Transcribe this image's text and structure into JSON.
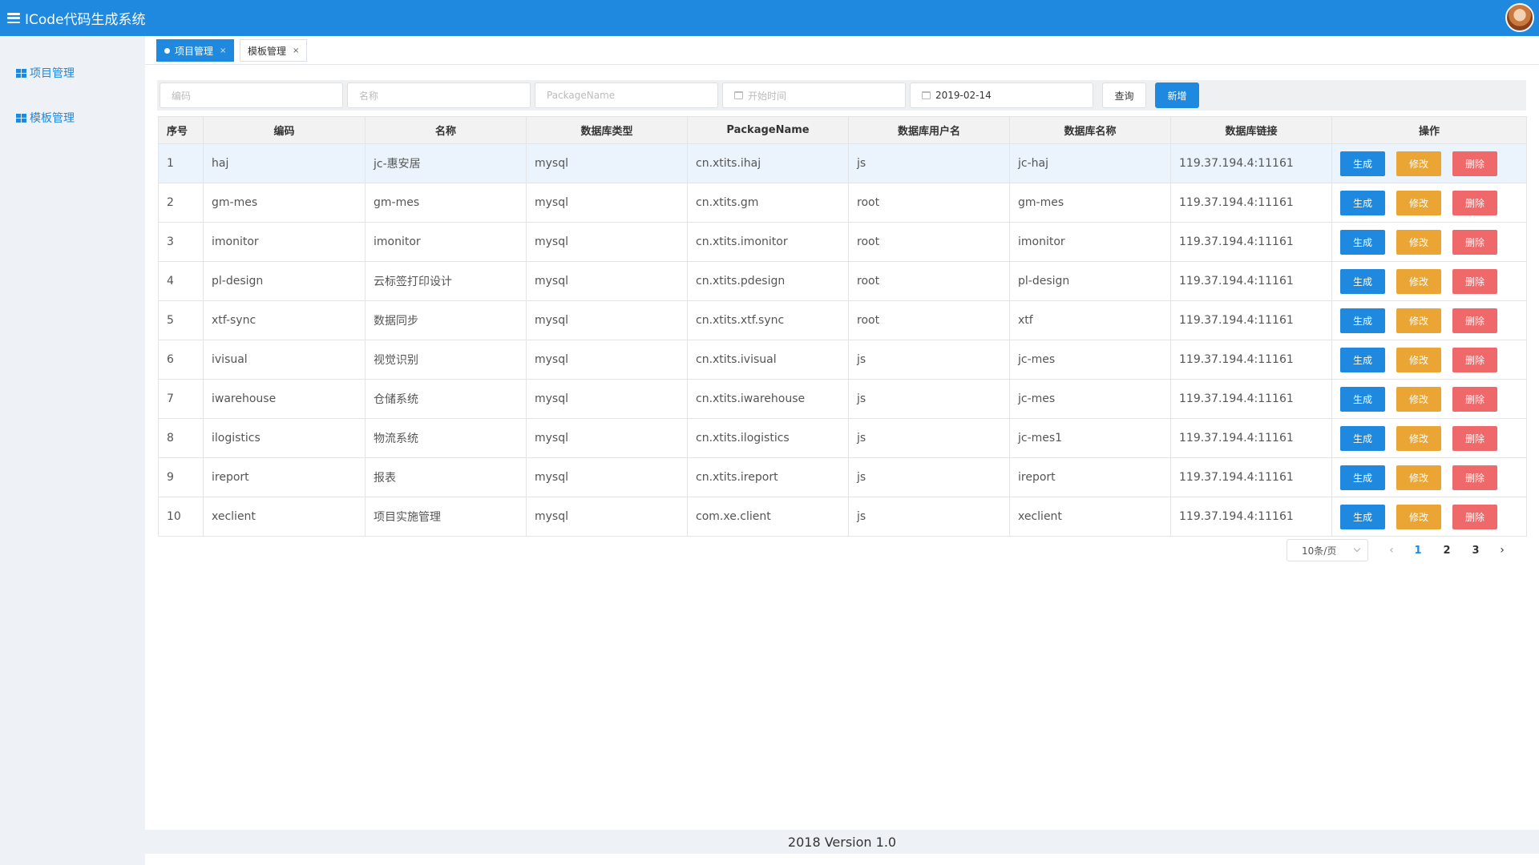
{
  "app": {
    "title": "ICode代码生成系统"
  },
  "sidebar": {
    "items": [
      {
        "label": "项目管理"
      },
      {
        "label": "模板管理"
      }
    ]
  },
  "tabs": [
    {
      "label": "项目管理",
      "active": true
    },
    {
      "label": "模板管理",
      "active": false
    }
  ],
  "search": {
    "code_placeholder": "编码",
    "name_placeholder": "名称",
    "package_placeholder": "PackageName",
    "start_placeholder": "开始时间",
    "end_value": "2019-02-14",
    "query_label": "查询",
    "add_label": "新增"
  },
  "table": {
    "headers": [
      "序号",
      "编码",
      "名称",
      "数据库类型",
      "PackageName",
      "数据库用户名",
      "数据库名称",
      "数据库链接",
      "操作"
    ],
    "rows": [
      [
        "1",
        "haj",
        "jc-惠安居",
        "mysql",
        "cn.xtits.ihaj",
        "js",
        "jc-haj",
        "119.37.194.4:11161"
      ],
      [
        "2",
        "gm-mes",
        "gm-mes",
        "mysql",
        "cn.xtits.gm",
        "root",
        "gm-mes",
        "119.37.194.4:11161"
      ],
      [
        "3",
        "imonitor",
        "imonitor",
        "mysql",
        "cn.xtits.imonitor",
        "root",
        "imonitor",
        "119.37.194.4:11161"
      ],
      [
        "4",
        "pl-design",
        "云标签打印设计",
        "mysql",
        "cn.xtits.pdesign",
        "root",
        "pl-design",
        "119.37.194.4:11161"
      ],
      [
        "5",
        "xtf-sync",
        "数据同步",
        "mysql",
        "cn.xtits.xtf.sync",
        "root",
        "xtf",
        "119.37.194.4:11161"
      ],
      [
        "6",
        "ivisual",
        "视觉识别",
        "mysql",
        "cn.xtits.ivisual",
        "js",
        "jc-mes",
        "119.37.194.4:11161"
      ],
      [
        "7",
        "iwarehouse",
        "仓储系统",
        "mysql",
        "cn.xtits.iwarehouse",
        "js",
        "jc-mes",
        "119.37.194.4:11161"
      ],
      [
        "8",
        "ilogistics",
        "物流系统",
        "mysql",
        "cn.xtits.ilogistics",
        "js",
        "jc-mes1",
        "119.37.194.4:11161"
      ],
      [
        "9",
        "ireport",
        "报表",
        "mysql",
        "cn.xtits.ireport",
        "js",
        "ireport",
        "119.37.194.4:11161"
      ],
      [
        "10",
        "xeclient",
        "项目实施管理",
        "mysql",
        "com.xe.client",
        "js",
        "xeclient",
        "119.37.194.4:11161"
      ]
    ],
    "actions": {
      "generate": "生成",
      "edit": "修改",
      "delete": "删除"
    }
  },
  "pagination": {
    "page_size": "10条/页",
    "pages": [
      "1",
      "2",
      "3"
    ],
    "current": "1"
  },
  "footer": {
    "text": "2018 Version 1.0"
  },
  "colors": {
    "primary": "#1e89de",
    "warning": "#eba534",
    "danger": "#f0696a"
  }
}
